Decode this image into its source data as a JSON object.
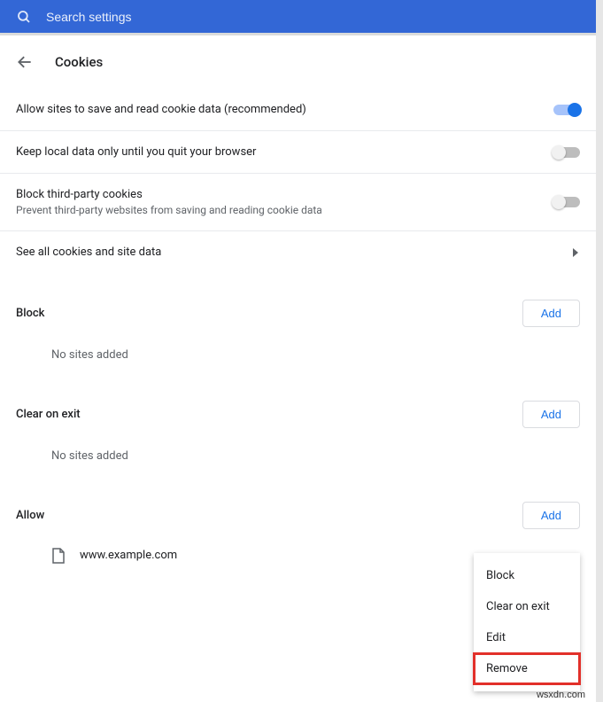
{
  "search": {
    "placeholder": "Search settings"
  },
  "header": {
    "title": "Cookies"
  },
  "rows": {
    "allow_cookies": {
      "label": "Allow sites to save and read cookie data (recommended)",
      "enabled": true
    },
    "keep_local": {
      "label": "Keep local data only until you quit your browser",
      "enabled": false
    },
    "block_third": {
      "label": "Block third-party cookies",
      "sublabel": "Prevent third-party websites from saving and reading cookie data",
      "enabled": false
    },
    "see_all": {
      "label": "See all cookies and site data"
    }
  },
  "sections": {
    "block": {
      "title": "Block",
      "add": "Add",
      "empty": "No sites added"
    },
    "clear": {
      "title": "Clear on exit",
      "add": "Add",
      "empty": "No sites added"
    },
    "allow": {
      "title": "Allow",
      "add": "Add",
      "site": "www.example.com"
    }
  },
  "menu": {
    "block": "Block",
    "clear": "Clear on exit",
    "edit": "Edit",
    "remove": "Remove"
  },
  "watermark": "wsxdn.com"
}
